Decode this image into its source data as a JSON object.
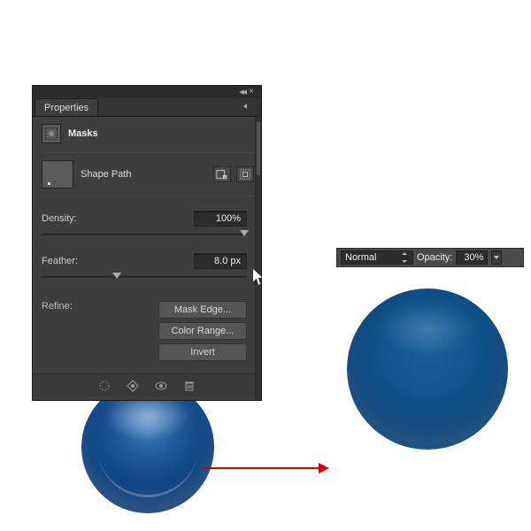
{
  "panel": {
    "tab_label": "Properties",
    "section_label": "Masks",
    "shape_label": "Shape Path",
    "density_label": "Density:",
    "density_value": "100%",
    "feather_label": "Feather:",
    "feather_value": "8.0 px",
    "refine_label": "Refine:",
    "btn_mask_edge": "Mask Edge...",
    "btn_color_range": "Color Range...",
    "btn_invert": "Invert"
  },
  "layerbar": {
    "blend_mode": "Normal",
    "opacity_label": "Opacity:",
    "opacity_value": "30%"
  },
  "colors": {
    "panel_bg": "#3e3e3e",
    "sphere_blue": "#0b4378",
    "arrow": "#d30000"
  }
}
